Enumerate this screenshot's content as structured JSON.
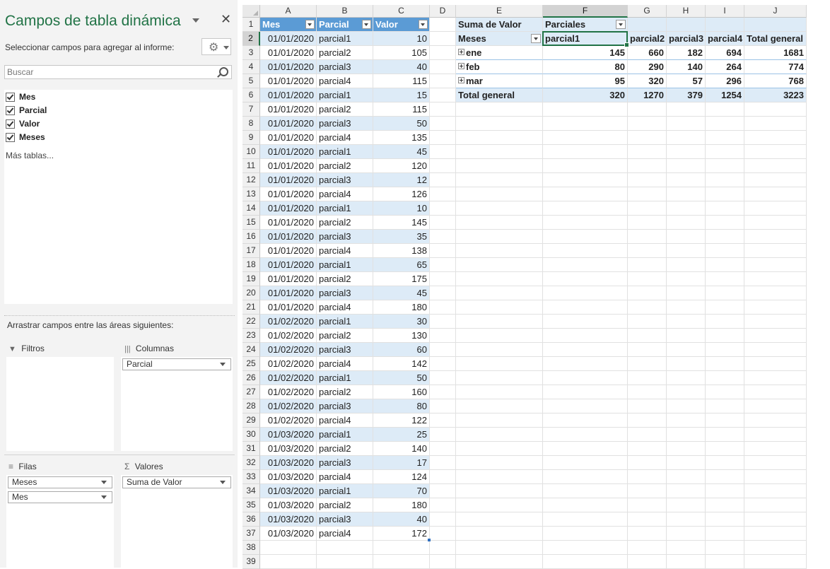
{
  "pane": {
    "title": "Campos de tabla dinámica",
    "subtitle": "Seleccionar campos para agregar al informe:",
    "search_placeholder": "Buscar",
    "fields": [
      {
        "label": "Mes",
        "checked": true
      },
      {
        "label": "Parcial",
        "checked": true
      },
      {
        "label": "Valor",
        "checked": true
      },
      {
        "label": "Meses",
        "checked": true
      }
    ],
    "more_tables": "Más tablas...",
    "drag_label": "Arrastrar campos entre las áreas siguientes:",
    "areas": {
      "filters": {
        "label": "Filtros",
        "items": []
      },
      "columns": {
        "label": "Columnas",
        "items": [
          "Parcial"
        ]
      },
      "rows": {
        "label": "Filas",
        "items": [
          "Meses",
          "Mes"
        ]
      },
      "values": {
        "label": "Valores",
        "items": [
          "Suma de Valor"
        ]
      }
    }
  },
  "sheet": {
    "columns": [
      "A",
      "B",
      "C",
      "D",
      "E",
      "F",
      "G",
      "H",
      "I",
      "J"
    ],
    "selected_column": "F",
    "selected_row": 2,
    "table_headers": [
      "Mes",
      "Parcial",
      "Valor"
    ],
    "table_rows": [
      [
        "01/01/2020",
        "parcial1",
        "10"
      ],
      [
        "01/01/2020",
        "parcial2",
        "105"
      ],
      [
        "01/01/2020",
        "parcial3",
        "40"
      ],
      [
        "01/01/2020",
        "parcial4",
        "115"
      ],
      [
        "01/01/2020",
        "parcial1",
        "15"
      ],
      [
        "01/01/2020",
        "parcial2",
        "115"
      ],
      [
        "01/01/2020",
        "parcial3",
        "50"
      ],
      [
        "01/01/2020",
        "parcial4",
        "135"
      ],
      [
        "01/01/2020",
        "parcial1",
        "45"
      ],
      [
        "01/01/2020",
        "parcial2",
        "120"
      ],
      [
        "01/01/2020",
        "parcial3",
        "12"
      ],
      [
        "01/01/2020",
        "parcial4",
        "126"
      ],
      [
        "01/01/2020",
        "parcial1",
        "10"
      ],
      [
        "01/01/2020",
        "parcial2",
        "145"
      ],
      [
        "01/01/2020",
        "parcial3",
        "35"
      ],
      [
        "01/01/2020",
        "parcial4",
        "138"
      ],
      [
        "01/01/2020",
        "parcial1",
        "65"
      ],
      [
        "01/01/2020",
        "parcial2",
        "175"
      ],
      [
        "01/01/2020",
        "parcial3",
        "45"
      ],
      [
        "01/01/2020",
        "parcial4",
        "180"
      ],
      [
        "01/02/2020",
        "parcial1",
        "30"
      ],
      [
        "01/02/2020",
        "parcial2",
        "130"
      ],
      [
        "01/02/2020",
        "parcial3",
        "60"
      ],
      [
        "01/02/2020",
        "parcial4",
        "142"
      ],
      [
        "01/02/2020",
        "parcial1",
        "50"
      ],
      [
        "01/02/2020",
        "parcial2",
        "160"
      ],
      [
        "01/02/2020",
        "parcial3",
        "80"
      ],
      [
        "01/02/2020",
        "parcial4",
        "122"
      ],
      [
        "01/03/2020",
        "parcial1",
        "25"
      ],
      [
        "01/03/2020",
        "parcial2",
        "140"
      ],
      [
        "01/03/2020",
        "parcial3",
        "17"
      ],
      [
        "01/03/2020",
        "parcial4",
        "124"
      ],
      [
        "01/03/2020",
        "parcial1",
        "70"
      ],
      [
        "01/03/2020",
        "parcial2",
        "180"
      ],
      [
        "01/03/2020",
        "parcial3",
        "40"
      ],
      [
        "01/03/2020",
        "parcial4",
        "172"
      ]
    ],
    "pivot": {
      "values_label": "Suma de Valor",
      "columns_label": "Parciales",
      "rows_label": "Meses",
      "column_items": [
        "parcial1",
        "parcial2",
        "parcial3",
        "parcial4",
        "Total general"
      ],
      "rows": [
        {
          "label": "ene",
          "values": [
            "145",
            "660",
            "182",
            "694",
            "1681"
          ]
        },
        {
          "label": "feb",
          "values": [
            "80",
            "290",
            "140",
            "264",
            "774"
          ]
        },
        {
          "label": "mar",
          "values": [
            "95",
            "320",
            "57",
            "296",
            "768"
          ]
        }
      ],
      "total": {
        "label": "Total general",
        "values": [
          "320",
          "1270",
          "379",
          "1254",
          "3223"
        ]
      }
    }
  }
}
